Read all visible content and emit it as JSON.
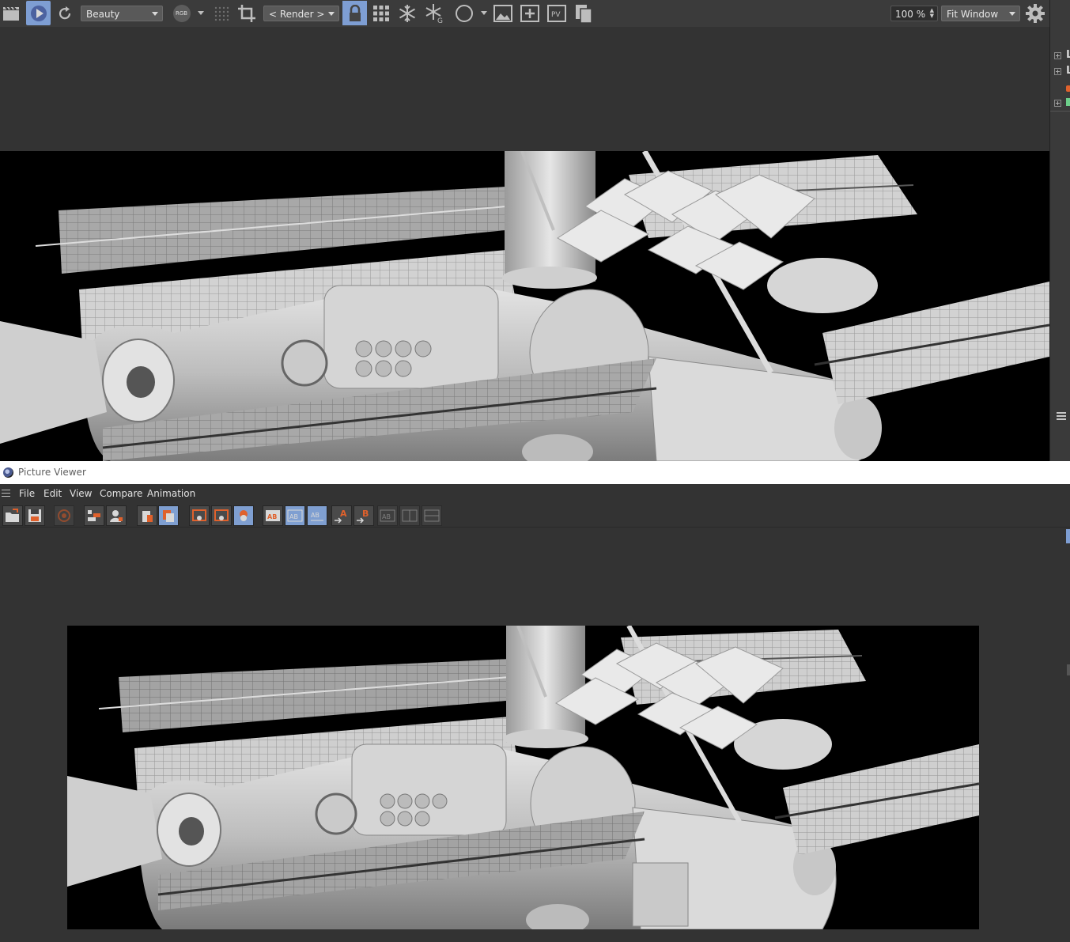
{
  "toolbar": {
    "channel_dropdown": "Beauty",
    "rgb_label": "RGB",
    "render_dropdown": "< Render >",
    "zoom_value": "100 %",
    "fit_dropdown": "Fit Window"
  },
  "right_panel": {
    "items": [
      "L",
      "L"
    ]
  },
  "picture_viewer": {
    "title": "Picture Viewer",
    "menu": [
      "File",
      "Edit",
      "View",
      "Compare",
      "Animation"
    ],
    "ab_label": "AB",
    "a_label": "A",
    "b_label": "B"
  },
  "colors": {
    "accent": "#7e9ed3",
    "panel_bg": "#333333",
    "toolbar_bg": "#3b3b3b",
    "orange": "#e0612c"
  },
  "icons": {
    "viewport_toolbar": [
      "clapper-icon",
      "render-view-icon",
      "refresh-icon",
      "rgb-icon",
      "grid-dots-icon",
      "crop-icon",
      "lock-icon",
      "grid-icon",
      "snowflake-icon",
      "snowflake-g-icon",
      "circle-icon",
      "image-icon",
      "add-image-icon",
      "pv-icon",
      "copy-icon",
      "gear-icon"
    ],
    "picture_viewer_toolbar": [
      "open-icon",
      "save-icon",
      "render-icon",
      "layers-icon",
      "user-icon",
      "delete-icon",
      "history-icon",
      "view-a-icon",
      "view-b-icon",
      "camera-icon",
      "ab-icon",
      "ab-split-icon",
      "ab-swap-icon",
      "set-a-icon",
      "set-b-icon",
      "compare-1-icon",
      "compare-2-icon",
      "compare-3-icon"
    ]
  }
}
